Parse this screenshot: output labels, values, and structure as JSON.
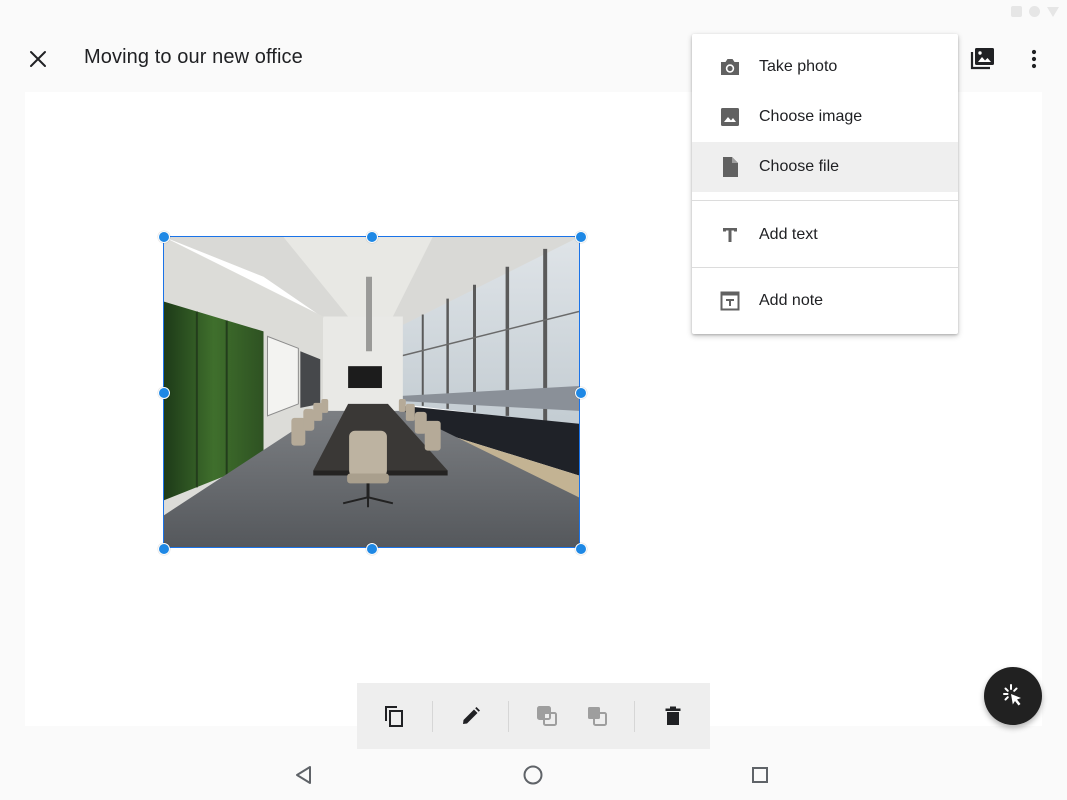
{
  "header": {
    "title": "Moving to our new office",
    "close_icon": "close-icon",
    "gallery_icon": "photo-library-icon",
    "more_icon": "more-vert-icon"
  },
  "insert_menu": {
    "items": [
      {
        "label": "Take photo",
        "icon": "camera-icon"
      },
      {
        "label": "Choose image",
        "icon": "image-icon"
      },
      {
        "label": "Choose file",
        "icon": "file-icon",
        "selected": true
      },
      {
        "label": "Add text",
        "icon": "text-icon"
      },
      {
        "label": "Add note",
        "icon": "note-icon"
      }
    ]
  },
  "canvas": {
    "selected_image": "conference-room-photo"
  },
  "bottom_toolbar": {
    "buttons": [
      "copy-icon",
      "edit-icon",
      "send-backward-icon",
      "bring-forward-icon",
      "delete-icon"
    ]
  },
  "fab": {
    "icon": "select-cursor-icon"
  },
  "system_nav": [
    "back-icon",
    "home-icon",
    "recents-icon"
  ],
  "colors": {
    "selection": "#1a73e8",
    "handle": "#1e88e5",
    "fab": "#212121",
    "menu_selected": "#efefef"
  }
}
